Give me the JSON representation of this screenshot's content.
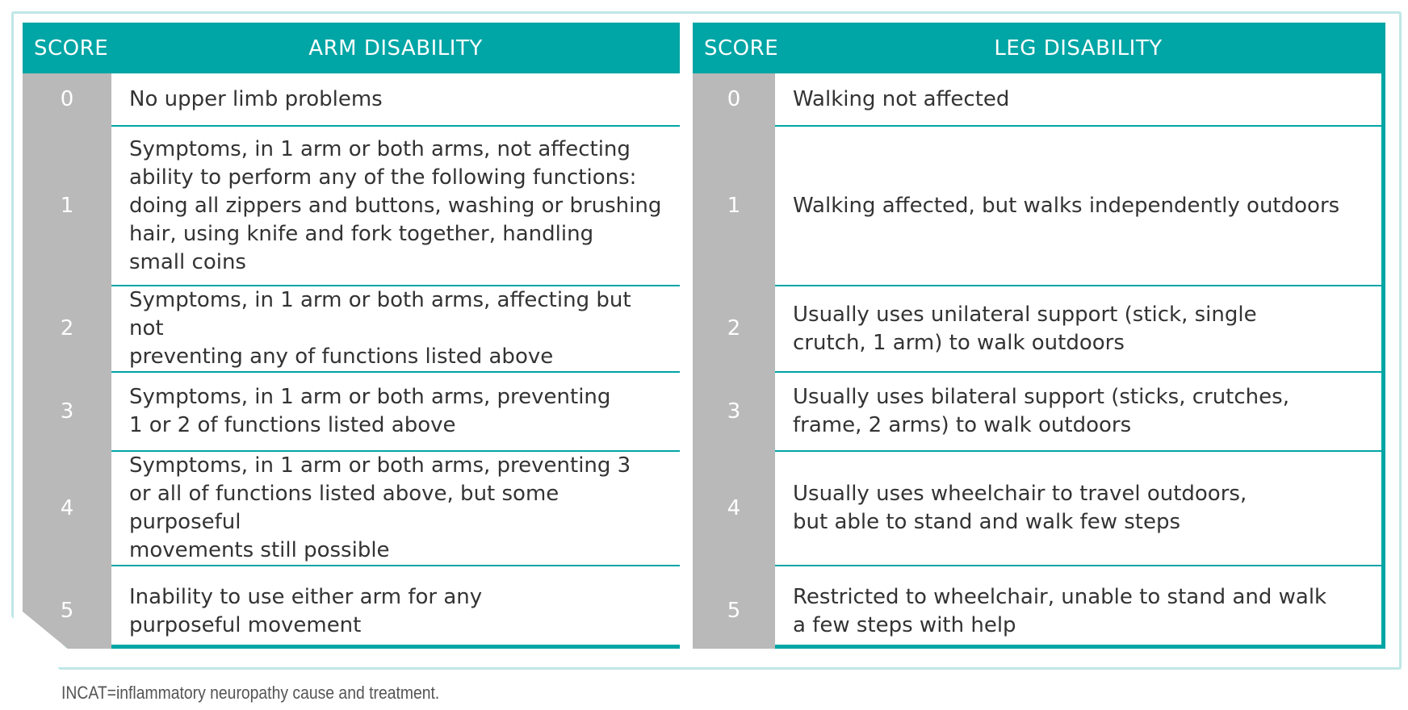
{
  "table": {
    "headers": {
      "score_left": "SCORE",
      "arm": "ARM DISABILITY",
      "score_right": "SCORE",
      "leg": "LEG DISABILITY"
    },
    "rows": [
      {
        "arm_score": "0",
        "arm_lines": [
          "No upper limb problems"
        ],
        "leg_score": "0",
        "leg_lines": [
          "Walking not affected"
        ]
      },
      {
        "arm_score": "1",
        "arm_lines": [
          "Symptoms, in 1 arm or both arms, not affecting",
          "ability to perform any of the following functions:",
          "doing all zippers and buttons, washing or brushing",
          "hair, using knife and fork together, handling",
          "small coins"
        ],
        "leg_score": "1",
        "leg_lines": [
          "Walking affected, but walks independently outdoors"
        ]
      },
      {
        "arm_score": "2",
        "arm_lines": [
          "Symptoms, in 1 arm or both arms, affecting but not",
          "preventing any of functions listed above"
        ],
        "leg_score": "2",
        "leg_lines": [
          "Usually uses unilateral support (stick, single",
          "crutch, 1 arm) to walk outdoors"
        ]
      },
      {
        "arm_score": "3",
        "arm_lines": [
          "Symptoms, in 1 arm or both arms, preventing",
          "1 or 2 of functions listed above"
        ],
        "leg_score": "3",
        "leg_lines": [
          "Usually uses bilateral support (sticks, crutches,",
          "frame, 2 arms) to walk outdoors"
        ]
      },
      {
        "arm_score": "4",
        "arm_lines": [
          "Symptoms, in 1 arm or both arms, preventing 3",
          "or all of functions listed above, but some purposeful",
          "movements still possible"
        ],
        "leg_score": "4",
        "leg_lines": [
          "Usually uses wheelchair to travel outdoors,",
          "but able to stand and walk few steps"
        ]
      },
      {
        "arm_score": "5",
        "arm_lines": [
          "Inability to use either arm for any",
          "purposeful movement"
        ],
        "leg_score": "5",
        "leg_lines": [
          "Restricted to wheelchair, unable to stand and walk",
          "a few steps with help"
        ]
      }
    ]
  },
  "footnote": "INCAT=inflammatory neuropathy cause and treatment.",
  "colors": {
    "header_teal": "#00a5a5",
    "score_gray": "#b9b9b9",
    "text": "#333333"
  }
}
